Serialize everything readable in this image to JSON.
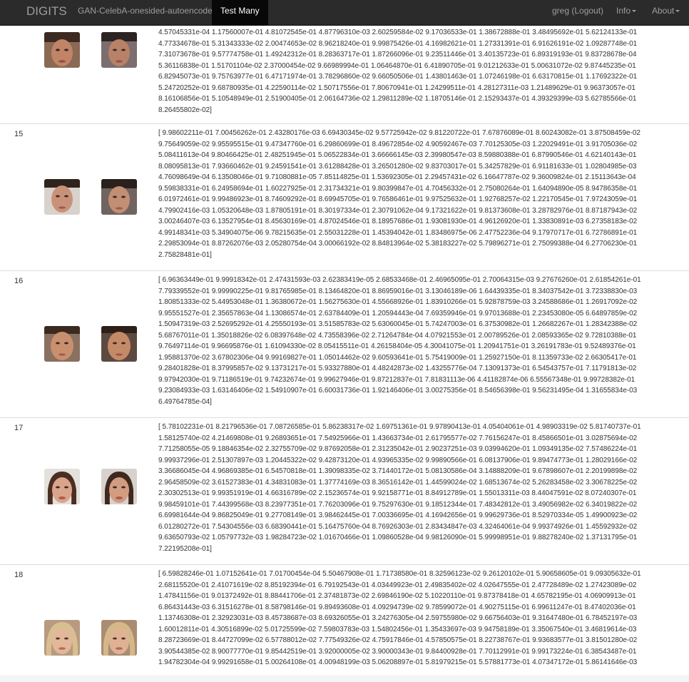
{
  "navbar": {
    "brand": "DIGITS",
    "model": "GAN-CelebA-onesided-autoencoder",
    "active_tab": "Test Many",
    "user": "greg (Logout)",
    "info": "Info",
    "about": "About"
  },
  "rows": [
    {
      "index": "",
      "vector": "4.57045331e-04 1.17560007e-01 4.81072545e-01 4.87796310e-03 2.60259584e-02 9.17036533e-01 1.38672888e-01 3.48495692e-01 5.62124133e-01\n4.77334678e-01 5.31343333e-02 2.00474653e-02 8.96218240e-01 9.99875426e-01 4.16982621e-01 1.27331391e-01 6.91626191e-02 1.09287748e-01\n7.31073678e-01 9.57774758e-01 1.49242312e-01 8.28363717e-01 1.87266096e-01 9.23511446e-01 3.40135723e-01 6.89319193e-01 9.83728678e-04\n5.36116838e-01 1.51701104e-02 2.37000454e-02 9.66989994e-01 1.06464870e-01 6.41890705e-01 9.01212633e-01 5.00631072e-02 9.87445235e-01\n6.82945073e-01 9.75763977e-01 6.47171974e-01 3.78296860e-02 9.66050506e-01 1.43801463e-01 1.07246198e-01 6.63170815e-01 1.17692322e-01\n5.24720252e-01 9.68780935e-01 4.22590114e-02 1.50717556e-01 7.80670941e-01 1.24299511e-01 4.28127311e-03 1.21489629e-01 9.96373057e-01\n8.16106856e-01 5.10548949e-01 2.51900405e-01 2.06164736e-02 1.29811289e-02 1.18705146e-01 2.15293437e-01 4.39329399e-03 5.62785566e-01\n8.26455802e-02]"
    },
    {
      "index": "15",
      "vector": "[ 9.98602211e-01 7.00456262e-01 2.43280176e-03 6.69430345e-02 9.57725942e-02 9.81220722e-01 7.67876089e-01 8.60243082e-01 3.87508459e-02\n9.75649059e-02 9.95595515e-01 9.47347760e-01 6.29860699e-01 8.49672854e-02 4.90592467e-03 7.70125305e-03 1.22029491e-01 3.91705036e-02\n5.08411613e-04 9.80466425e-01 2.48251945e-01 5.06522834e-01 3.66666145e-03 2.39980547e-03 8.59880388e-01 6.87990546e-01 4.62140143e-01\n8.08095813e-01 7.93660462e-01 9.24591541e-01 3.61288428e-01 3.26501280e-02 9.83703017e-01 5.34257829e-01 6.91181633e-01 1.02804985e-03\n4.76098649e-04 6.13508046e-01 9.71080881e-05 7.85114825e-01 1.53692305e-01 2.29457431e-02 6.16647787e-02 9.36009824e-01 2.15113643e-04\n9.59838331e-01 6.24958694e-01 1.60227925e-01 2.31734321e-01 9.80399847e-01 4.70456332e-01 2.75080264e-01 1.64094890e-05 8.94786358e-01\n6.01972461e-01 9.99486923e-01 8.74609292e-01 8.69945705e-01 9.76586461e-01 9.97525632e-01 1.92768257e-02 1.22170545e-01 7.97243059e-01\n4.79902416e-03 1.05320648e-03 1.87805191e-01 8.30197334e-01 2.30791062e-04 9.17321622e-01 9.81373608e-01 3.28782976e-01 8.87187943e-02\n3.00246407e-03 6.13527954e-01 8.45630169e-01 4.87024546e-01 8.18957686e-01 1.93081930e-01 4.96126920e-01 1.33830891e-03 6.27358183e-02\n4.99148341e-03 5.34904075e-06 9.78215635e-01 2.55031228e-01 1.45394042e-01 1.83486975e-06 2.47752236e-04 9.17970717e-01 6.72786891e-01\n2.29853094e-01 8.87262076e-03 2.05280754e-04 3.00066192e-02 8.84813964e-02 5.38183227e-02 5.79896271e-01 2.75099388e-04 6.27706230e-01\n2.75828481e-01]"
    },
    {
      "index": "16",
      "vector": "[ 6.96363449e-01 9.99918342e-01 2.47431593e-03 2.62383419e-05 2.68533468e-01 2.46965095e-01 2.70064315e-03 9.27676260e-01 2.61854261e-01\n7.79339552e-01 9.99990225e-01 9.81765985e-01 8.13464820e-01 8.86959016e-01 3.13046189e-06 1.64439335e-01 8.34037542e-01 3.72338830e-03\n1.80851333e-02 5.44953048e-01 1.36380672e-01 1.56275630e-01 4.55668926e-01 1.83910266e-01 5.92878759e-03 3.24588686e-01 1.26917092e-02\n9.95551527e-01 2.35657863e-04 1.13086574e-01 2.63784409e-01 1.20594443e-04 7.69359946e-01 9.97013688e-01 2.23453080e-05 6.64897859e-02\n1.50947319e-03 2.52695292e-01 4.25550193e-01 3.51585783e-02 5.63060045e-01 5.74247003e-01 6.37530982e-01 1.26682267e-01 1.28342388e-02\n5.68767011e-01 1.35018826e-02 6.08397648e-02 4.73558396e-02 2.71264784e-04 4.07921553e-01 2.00789526e-01 2.08593365e-02 9.72810388e-01\n9.76497114e-01 9.96695876e-01 1.61094330e-02 8.05415511e-01 4.26158404e-05 4.30041075e-01 1.20941751e-01 3.26191783e-01 9.52489376e-01\n1.95881370e-02 3.67802306e-04 9.99169827e-01 1.05014462e-02 9.60593641e-01 5.75419009e-01 1.25927150e-01 8.11359733e-02 2.66305417e-01\n9.28401828e-01 8.37995857e-02 9.13731217e-01 5.93327880e-01 4.48242873e-02 1.43255776e-04 7.13091373e-01 6.54543757e-01 7.11791813e-02\n9.97942030e-01 9.71186519e-01 9.74232674e-01 9.99627946e-01 9.87212837e-01 7.81831113e-06 4.41182874e-06 6.55567348e-01 9.99728382e-01\n9.23084933e-03 1.63146406e-02 1.54910907e-01 6.60031736e-01 1.92146406e-01 3.00275356e-01 8.54656398e-01 9.56231495e-04 1.31655834e-03\n6.49764785e-04]"
    },
    {
      "index": "17",
      "vector": "[ 5.78102231e-01 8.21796536e-01 7.08726585e-01 5.86238317e-02 1.69751361e-01 9.97890413e-01 4.05404061e-01 4.98903319e-02 5.81740737e-01\n1.58125740e-02 4.21469808e-01 9.26893651e-01 7.54925966e-01 1.43663734e-01 2.61795577e-02 7.76156247e-01 8.45866501e-01 3.02875694e-02\n7.71258055e-05 9.18846354e-02 2.32755709e-02 9.87692058e-01 2.31235042e-01 2.90237251e-03 9.03994620e-01 1.09349135e-02 7.57486224e-01\n9.99937296e-01 2.51307897e-03 1.20445322e-02 9.42873120e-01 4.93965335e-02 9.99890566e-01 6.08137906e-01 9.89474773e-01 1.28029166e-02\n3.36686045e-04 4.96869385e-01 6.54570818e-01 1.39098335e-02 3.71440172e-01 5.08130586e-04 3.14888209e-01 9.67898607e-01 2.20199898e-02\n2.96458509e-02 3.61527383e-01 4.34831083e-01 1.37774169e-03 8.36516142e-01 1.44599024e-02 1.68513674e-02 5.26283458e-02 3.30678225e-02\n2.30302513e-01 9.99351919e-01 4.66316789e-02 2.15236574e-01 9.92158771e-01 8.84912789e-01 1.55013311e-03 8.44047591e-02 8.07240307e-01\n9.98459101e-01 7.44399568e-03 8.23977351e-01 7.76203096e-01 9.75297630e-01 9.18512344e-01 7.48342812e-01 3.49056982e-02 6.34019822e-02\n6.69981644e-04 9.86825049e-01 9.27708149e-01 3.98462445e-01 7.00336695e-01 4.16942656e-01 9.99629736e-01 8.52970334e-05 1.49900923e-02\n6.01280272e-01 7.54304556e-03 6.68390441e-01 5.16475760e-04 8.76926303e-01 2.83434847e-03 4.32464061e-04 9.99374926e-01 1.45592932e-02\n9.63650793e-02 1.05797732e-03 1.98284723e-02 1.01670466e-01 1.09860528e-04 9.98126090e-01 5.99998951e-01 9.88278240e-02 1.37131795e-01\n7.22195208e-01]"
    },
    {
      "index": "18",
      "vector": "[ 6.59828246e-01 1.07152641e-01 7.01700454e-04 5.50467908e-01 1.71738580e-01 8.32596123e-02 9.26120102e-01 5.90658605e-01 9.09305632e-01\n2.68115520e-01 2.41071619e-02 8.85192394e-01 6.79192543e-01 4.03449923e-01 2.49835402e-02 4.02647555e-01 2.47728489e-02 1.27423089e-02\n1.47841156e-01 9.01372492e-01 8.88441706e-01 2.37481873e-02 2.69846190e-02 5.10220110e-01 9.87378418e-01 4.65782195e-01 4.06909913e-01\n6.86431443e-03 6.31516278e-01 8.58798146e-01 9.89493608e-01 4.09294739e-02 9.78599072e-01 4.90275115e-01 6.99611247e-01 8.47402036e-01\n1.13746308e-01 2.32923031e-03 8.45738687e-03 8.69326055e-01 3.24276305e-04 2.59755980e-02 9.66756403e-01 9.31647480e-01 6.78452197e-03\n1.60012811e-01 4.30516899e-02 5.01725599e-02 7.59803783e-03 1.54802456e-01 1.35433697e-03 9.94758189e-01 3.35067540e-01 3.46819614e-03\n8.28723669e-01 8.44727099e-02 6.57788012e-02 7.77549326e-02 4.75917846e-01 4.57850575e-01 8.22738767e-01 9.93683577e-01 3.81501280e-02\n3.90544385e-02 8.90077770e-01 9.85442519e-01 3.92000005e-02 3.90000343e-01 9.84400928e-01 7.70112991e-01 9.99173224e-01 6.38543487e-01\n1.94782304e-04 9.99291658e-01 5.00264108e-01 4.00948199e-03 5.06208897e-01 5.81979215e-01 5.57881773e-01 4.07347172e-01 5.86141646e-03"
    }
  ]
}
